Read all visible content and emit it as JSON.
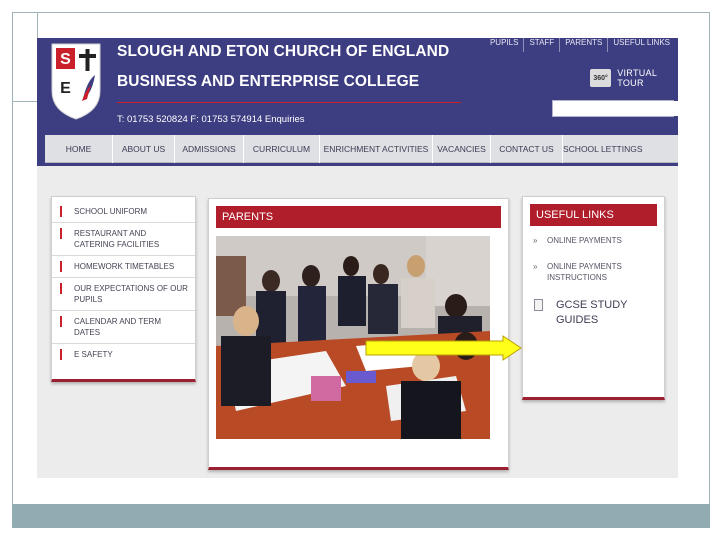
{
  "header": {
    "logo_letters": [
      "S",
      "E"
    ],
    "title_line1": "SLOUGH AND ETON CHURCH OF ENGLAND",
    "title_line2": "BUSINESS AND ENTERPRISE COLLEGE",
    "contact": "T: 01753 520824    F: 01753 574914    Enquiries",
    "top_links": [
      "PUPILS",
      "STAFF",
      "PARENTS",
      "USEFUL LINKS"
    ],
    "virtual_tour": {
      "badge": "360°",
      "label": "VIRTUAL TOUR"
    },
    "search": {
      "value": "",
      "placeholder": ""
    }
  },
  "nav": {
    "items": [
      "HOME",
      "ABOUT US",
      "ADMISSIONS",
      "CURRICULUM",
      "ENRICHMENT ACTIVITIES",
      "VACANCIES",
      "CONTACT US",
      "SCHOOL LETTINGS"
    ]
  },
  "left_menu": {
    "items": [
      "SCHOOL UNIFORM",
      "RESTAURANT AND CATERING FACILITIES",
      "HOMEWORK TIMETABLES",
      "OUR EXPECTATIONS OF OUR PUPILS",
      "CALENDAR AND TERM DATES",
      "E SAFETY"
    ]
  },
  "parents_panel": {
    "title": "PARENTS"
  },
  "useful_links": {
    "title": "USEFUL LINKS",
    "items": [
      "ONLINE PAYMENTS",
      "ONLINE PAYMENTS INSTRUCTIONS",
      "GCSE STUDY GUIDES"
    ]
  },
  "icons": [
    "search-icon",
    "document-icon",
    "arrow-right-icon",
    "cross-icon",
    "dove-icon"
  ],
  "colors": {
    "header": "#3d3d82",
    "accent_red": "#b01d2b",
    "arrow": "#ffff1a",
    "frame": "#91abb2"
  }
}
